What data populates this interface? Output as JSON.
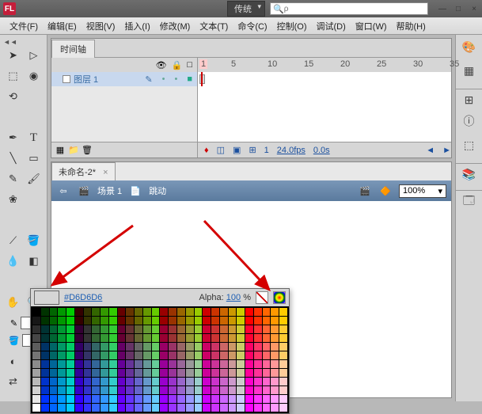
{
  "app": {
    "logo_text": "FL",
    "layout_dropdown": "传统",
    "search_placeholder": "ρ"
  },
  "menu": {
    "file": "文件(F)",
    "edit": "编辑(E)",
    "view": "视图(V)",
    "insert": "插入(I)",
    "modify": "修改(M)",
    "text": "文本(T)",
    "commands": "命令(C)",
    "control": "控制(O)",
    "debug": "调试(D)",
    "window": "窗口(W)",
    "help": "帮助(H)"
  },
  "timeline": {
    "tab_label": "时间轴",
    "layer_name": "图层 1",
    "frame_numbers": [
      "1",
      "5",
      "10",
      "15",
      "20",
      "25",
      "30",
      "35"
    ],
    "current_frame": "1",
    "fps": "24.0fps",
    "time": "0.0s"
  },
  "document": {
    "tab": "未命名-2*",
    "scene_label": "场景 1",
    "symbol_label": "跳动",
    "zoom": "100%"
  },
  "color_popup": {
    "hex": "#D6D6D6",
    "alpha_label": "Alpha:",
    "alpha_value": "100",
    "alpha_pct": "%"
  },
  "win_controls": {
    "min": "—",
    "max": "□",
    "close": "×"
  }
}
